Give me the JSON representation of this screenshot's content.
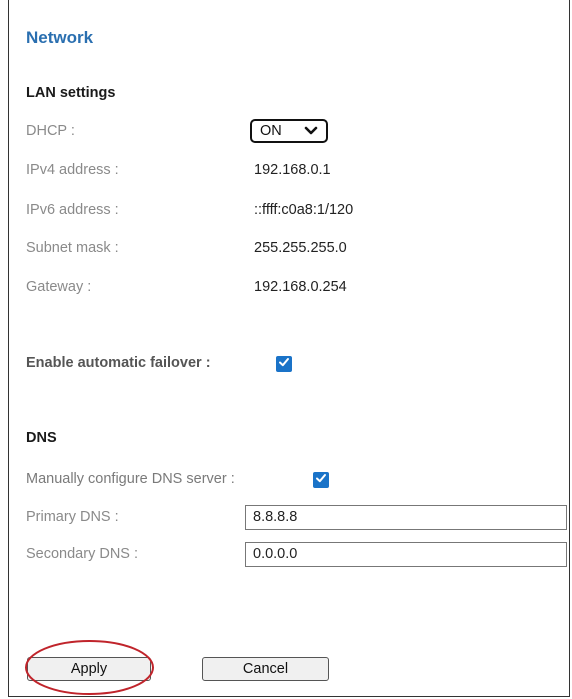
{
  "page": {
    "title": "Network"
  },
  "lan": {
    "heading": "LAN settings",
    "dhcp_label": "DHCP :",
    "dhcp_value": "ON",
    "ipv4_label": "IPv4 address :",
    "ipv4_value": "192.168.0.1",
    "ipv6_label": "IPv6 address :",
    "ipv6_value": "::ffff:c0a8:1/120",
    "subnet_label": "Subnet mask :",
    "subnet_value": "255.255.255.0",
    "gateway_label": "Gateway :",
    "gateway_value": "192.168.0.254"
  },
  "failover": {
    "label": "Enable automatic failover :",
    "checked": true
  },
  "dns": {
    "heading": "DNS",
    "manual_label": "Manually configure DNS server :",
    "manual_checked": true,
    "primary_label": "Primary DNS :",
    "primary_value": "8.8.8.8",
    "secondary_label": "Secondary DNS :",
    "secondary_value": "0.0.0.0"
  },
  "actions": {
    "apply_label": "Apply",
    "cancel_label": "Cancel"
  },
  "colors": {
    "title": "#2a6fb0",
    "checkbox": "#1a73c8",
    "highlight": "#c0242b"
  },
  "icons": [
    "chevron-down-icon",
    "checkmark-icon"
  ]
}
